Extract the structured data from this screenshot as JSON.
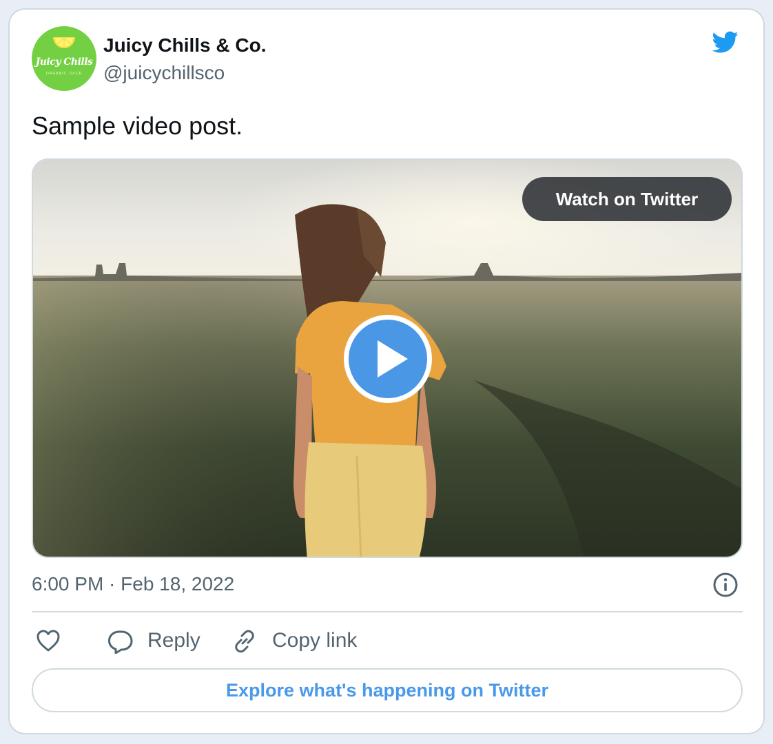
{
  "author": {
    "name": "Juicy Chills & Co.",
    "handle": "@juicychillsco",
    "avatar_brand": "Juicy Chills",
    "avatar_subtext": "ORGANIC JUICE"
  },
  "tweet": {
    "text": "Sample video post.",
    "timestamp": "6:00 PM · Feb 18, 2022"
  },
  "media": {
    "watch_label": "Watch on Twitter"
  },
  "actions": {
    "reply_label": "Reply",
    "copy_link_label": "Copy link"
  },
  "footer": {
    "explore_label": "Explore what's happening on Twitter"
  },
  "icons": [
    "twitter-bird-icon",
    "play-icon",
    "info-icon",
    "heart-icon",
    "reply-icon",
    "link-icon"
  ],
  "colors": {
    "twitter_blue": "#1d9bf0",
    "link_blue": "#4a99e9",
    "avatar_green": "#74d043",
    "text_primary": "#0f1419",
    "text_secondary": "#536471",
    "border": "#cfd9de"
  }
}
